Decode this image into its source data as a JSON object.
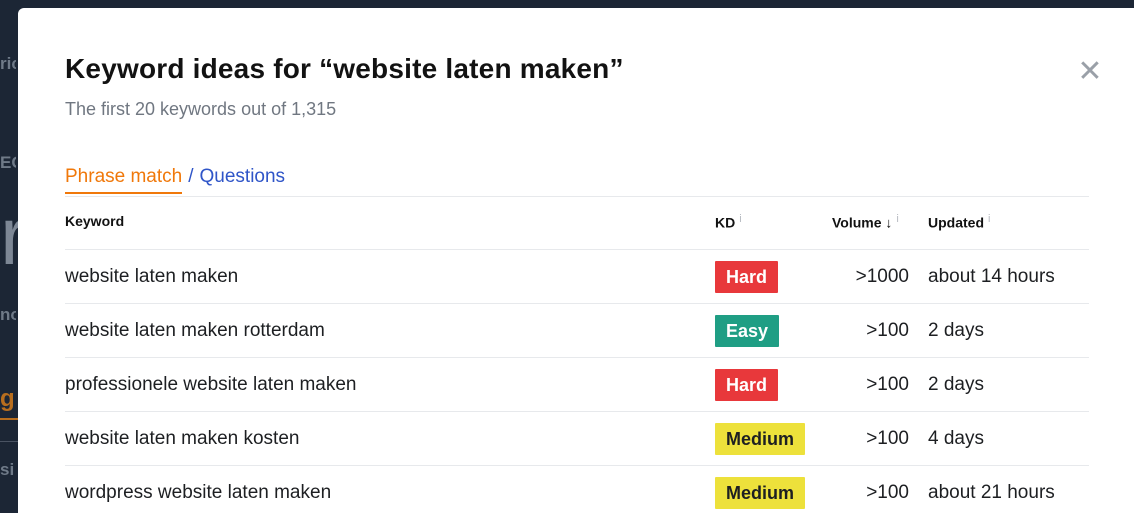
{
  "background": {
    "fragments": [
      "ric",
      "EC",
      "r",
      "no",
      "g",
      "si"
    ]
  },
  "modal": {
    "title": "Keyword ideas for “website laten maken”",
    "subtitle": "The first 20 keywords out of 1,315",
    "close_icon": "close-icon",
    "tabs": {
      "phrase_match": "Phrase match",
      "separator": "/",
      "questions": "Questions"
    },
    "table": {
      "headers": {
        "keyword": "Keyword",
        "kd": "KD",
        "volume": "Volume ↓",
        "updated": "Updated",
        "info_glyph": "i"
      },
      "rows": [
        {
          "keyword": "website laten maken",
          "kd": "Hard",
          "kd_color": "#e8383b",
          "kd_text_color": "#ffffff",
          "volume": ">1000",
          "updated": "about 14 hours"
        },
        {
          "keyword": "website laten maken rotterdam",
          "kd": "Easy",
          "kd_color": "#1f9e84",
          "kd_text_color": "#ffffff",
          "volume": ">100",
          "updated": "2 days"
        },
        {
          "keyword": "professionele website laten maken",
          "kd": "Hard",
          "kd_color": "#e8383b",
          "kd_text_color": "#ffffff",
          "volume": ">100",
          "updated": "2 days"
        },
        {
          "keyword": "website laten maken kosten",
          "kd": "Medium",
          "kd_color": "#ede13b",
          "kd_text_color": "#1d1f22",
          "volume": ">100",
          "updated": "4 days"
        },
        {
          "keyword": "wordpress website laten maken",
          "kd": "Medium",
          "kd_color": "#ede13b",
          "kd_text_color": "#1d1f22",
          "volume": ">100",
          "updated": "about 21 hours"
        }
      ]
    }
  }
}
